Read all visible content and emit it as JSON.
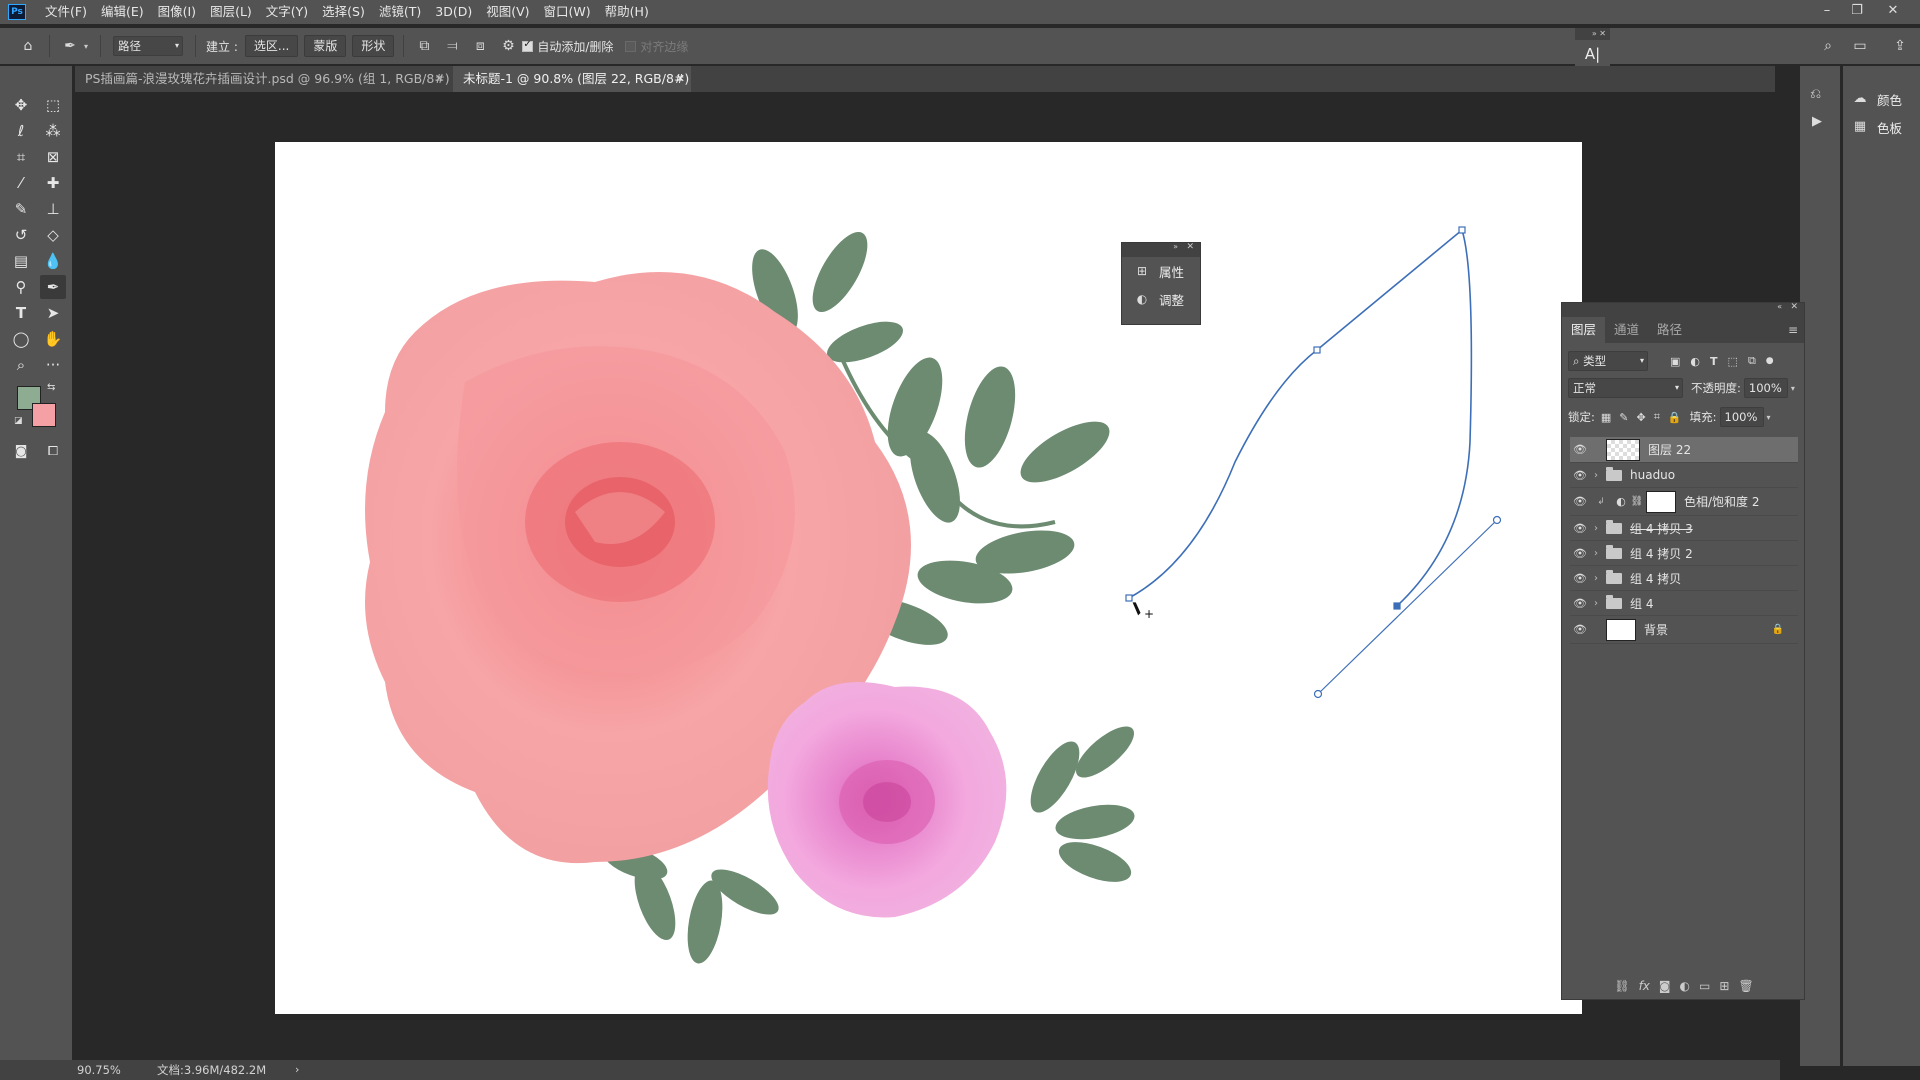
{
  "app": {
    "logo": "Ps",
    "menu": [
      "文件(F)",
      "编辑(E)",
      "图像(I)",
      "图层(L)",
      "文字(Y)",
      "选择(S)",
      "滤镜(T)",
      "3D(D)",
      "视图(V)",
      "窗口(W)",
      "帮助(H)"
    ]
  },
  "options_bar": {
    "mode_value": "路径",
    "make_label": "建立 :",
    "selection_button": "选区...",
    "mask_button": "蒙版",
    "shape_button": "形状",
    "auto_add_delete_label": "自动添加/删除",
    "auto_add_delete_checked": true,
    "align_edges_label": "对齐边缘",
    "align_edges_checked": false
  },
  "tabs": [
    {
      "label": "PS插画篇-浪漫玫瑰花卉插画设计.psd @ 96.9% (组 1, RGB/8#)",
      "active": false
    },
    {
      "label": "未标题-1 @ 90.8% (图层 22, RGB/8#) *",
      "active": true
    }
  ],
  "tools": {
    "foreground_color": "#8eac92",
    "background_color": "#f4a0a4"
  },
  "mini_panel": {
    "items": [
      {
        "icon": "properties-icon",
        "label": "属性"
      },
      {
        "icon": "adjustments-icon",
        "label": "调整"
      }
    ]
  },
  "dock": {
    "items": [
      {
        "icon": "color-icon",
        "label": "颜色"
      },
      {
        "icon": "swatches-icon",
        "label": "色板"
      }
    ]
  },
  "layers_panel": {
    "tabs": [
      "图层",
      "通道",
      "路径"
    ],
    "active_tab": "图层",
    "filter_type": "类型",
    "blend_mode": "正常",
    "opacity_label": "不透明度:",
    "opacity_value": "100%",
    "lock_label": "锁定:",
    "fill_label": "填充:",
    "fill_value": "100%",
    "layers": [
      {
        "name": "图层 22",
        "kind": "pixel",
        "selected": true,
        "visible": true
      },
      {
        "name": "huaduo",
        "kind": "group",
        "selected": false,
        "visible": true
      },
      {
        "name": "色相/饱和度 2",
        "kind": "adjustment",
        "selected": false,
        "visible": true
      },
      {
        "name": "组 4 拷贝 3",
        "kind": "group",
        "selected": false,
        "visible": true,
        "strikethrough": true
      },
      {
        "name": "组 4 拷贝 2",
        "kind": "group",
        "selected": false,
        "visible": true
      },
      {
        "name": "组 4 拷贝",
        "kind": "group",
        "selected": false,
        "visible": true
      },
      {
        "name": "组 4",
        "kind": "group",
        "selected": false,
        "visible": true
      },
      {
        "name": "背景",
        "kind": "background",
        "selected": false,
        "visible": true,
        "locked": true
      }
    ]
  },
  "status": {
    "zoom": "90.75%",
    "doc_size": "文档:3.96M/482.2M"
  }
}
